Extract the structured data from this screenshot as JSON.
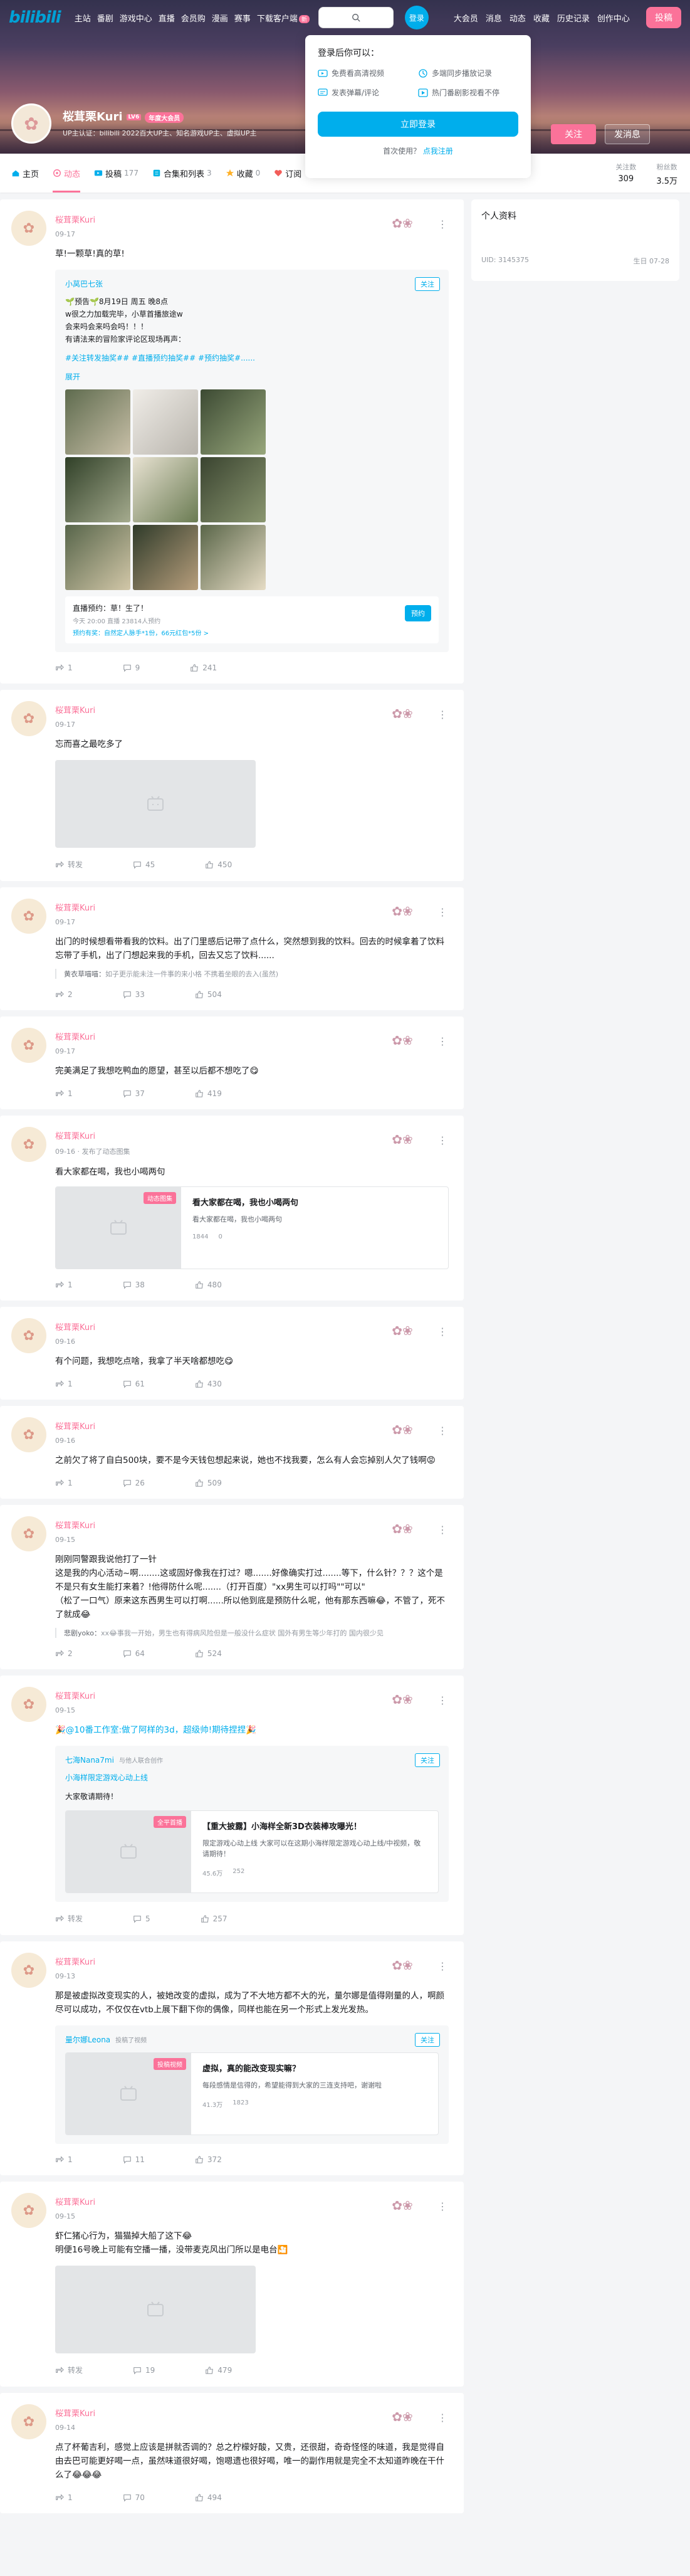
{
  "topbar": {
    "logo": "bilibili",
    "nav": [
      "主站",
      "番剧",
      "游戏中心",
      "直播",
      "会员购",
      "漫画",
      "赛事",
      "下载客户端"
    ],
    "download_badge": "新",
    "login_label": "登录",
    "right_nav": [
      "大会员",
      "消息",
      "动态",
      "收藏",
      "历史记录",
      "创作中心"
    ],
    "upload_label": "投稿"
  },
  "popover": {
    "title": "登录后你可以：",
    "features": [
      "免费看高清视频",
      "多端同步播放记录",
      "发表弹幕/评论",
      "热门番剧影视看不停"
    ],
    "login_button": "立即登录",
    "first_use": "首次使用？",
    "register": "点我注册"
  },
  "profile": {
    "name": "桜茸栗Kuri",
    "level": "LV6",
    "vip": "年度大会员",
    "sign": "UP主认证：bilibili 2022百大UP主、知名游戏UP主、虚拟UP主",
    "follow_button": "关注",
    "message_button": "发消息"
  },
  "tabs": [
    {
      "label": "主页",
      "count": ""
    },
    {
      "label": "动态",
      "count": ""
    },
    {
      "label": "投稿",
      "count": "177"
    },
    {
      "label": "合集和列表",
      "count": "3"
    },
    {
      "label": "收藏",
      "count": "0"
    },
    {
      "label": "订阅",
      "count": ""
    }
  ],
  "stats": [
    {
      "label": "关注数",
      "value": "309"
    },
    {
      "label": "粉丝数",
      "value": "3.5万"
    }
  ],
  "sidebar": {
    "title": "个人资料",
    "uid": "UID: 3145375",
    "birthday": "生日 07-28"
  },
  "posts": [
    {
      "name": "桜茸栗Kuri",
      "time": "09-17",
      "text": "草!一颗草!真的草!",
      "forward": {
        "name": "小莴巴七张",
        "follow": "关注",
        "text": "🌱预告🌱8月19日 周五 晚8点\nw很之力加载完毕，小草首播旅途w\n会来吗会来吗会吗！！！\n有请法来的冒险家评论区现场再声：",
        "tags": "#关注转发抽奖## #直播预约抽奖## #预约抽奖#......",
        "expand": "展开",
        "live_title": "直播预约：草！生了！",
        "live_sub": "今天 20:00 直播   23814人预约",
        "live_link": "预约有奖：自然定人脉手*1份，66元红包*5份 >",
        "live_btn": "预约"
      },
      "forward_count": "1",
      "comment_count": "9",
      "like_count": "241"
    },
    {
      "name": "桜茸栗Kuri",
      "time": "09-17",
      "text": "忘而喜之最吃多了",
      "forward_count": "转发",
      "comment_count": "45",
      "like_count": "450"
    },
    {
      "name": "桜茸栗Kuri",
      "time": "09-17",
      "text": "出门的时候想看带看我的饮料。出了门里感后记带了点什么，突然想到我的饮料。回去的时候拿着了饮料忘带了手机，出了门想起来我的手机，回去又忘了饮料......",
      "comment": {
        "user": "黄衣草喵喵：",
        "text": "如子更示能未注一件事的来小格 不携着坐眼的去入(虽然)"
      },
      "forward_count": "2",
      "comment_count": "33",
      "like_count": "504"
    },
    {
      "name": "桜茸栗Kuri",
      "time": "09-17",
      "text": "完美满足了我想吃鸭血的愿望，甚至以后都不想吃了😋",
      "forward_count": "1",
      "comment_count": "37",
      "like_count": "419"
    },
    {
      "name": "桜茸栗Kuri",
      "time": "09-16 · 发布了动态图集",
      "text": "看大家都在喝，我也小喝两句",
      "box": {
        "tag": "动态图集",
        "title": "看大家都在喝，我也小喝两句",
        "desc": "看大家都在喝，我也小喝两句",
        "views": "1844",
        "cmts": "0"
      },
      "forward_count": "1",
      "comment_count": "38",
      "like_count": "480"
    },
    {
      "name": "桜茸栗Kuri",
      "time": "09-16",
      "text": "有个问题，我想吃点啥，我拿了半天啥都想吃😋",
      "forward_count": "1",
      "comment_count": "61",
      "like_count": "430"
    },
    {
      "name": "桜茸栗Kuri",
      "time": "09-16",
      "text": "之前欠了将了自白500块，要不是今天钱包想起来说，她也不找我要，怎么有人会忘掉别人欠了钱啊😡",
      "forward_count": "1",
      "comment_count": "26",
      "like_count": "509"
    },
    {
      "name": "桜茸栗Kuri",
      "time": "09-15",
      "text": "刚刚同警跟我说他打了一针\n这是我的内心活动~啊........这或固好像我在打过？嗯.......好像确实打过.......等下，什么针？？？这个是不是只有女生能打来着？!他得防什么呢.......（打开百度）\"xx男生可以打吗\"\"可以\"\n（松了一口气）原来这东西男生可以打啊......所以他到底是预防什么呢，他有那东西嘛😂，不管了，死不了就成😂",
      "comment": {
        "user": "悲剧yoko：",
        "text": "xx😂事我一开始，男生也有得病风险但是一般没什么症状 国外有男生等少年打的 国内很少见"
      },
      "forward_count": "2",
      "comment_count": "64",
      "like_count": "524"
    },
    {
      "name": "桜茸栗Kuri",
      "time": "09-15",
      "text": "🎉@10番工作室:做了阿样的3d，超级帅!期待捏捏🎉",
      "forward": {
        "name": "七海Nana7mi",
        "sub": "与他人联合创作",
        "follow": "关注",
        "link": "小海样限定游戏心动上线",
        "text": "大家敬请期待！",
        "box": {
          "tag": "全平首播",
          "title": "【重大披露】小海样全新3D衣装棒攻曝光！",
          "desc": "限定游戏心动上线 大家可以在这期小海样限定游戏心动上线/中视频，敬请期待！",
          "views": "45.6万",
          "cmts": "252"
        }
      },
      "forward_count": "转发",
      "comment_count": "5",
      "like_count": "257"
    },
    {
      "name": "桜茸栗Kuri",
      "time": "09-13",
      "text": "那是被虚拟改变现实的人，被她改变的虚拟，成为了不大地方都不大的光，量尔娜是值得刚量的人，啊颜尽可以成功，不仅仅在vtb上展下翻下你的偶像，同样也能在另一个形式上发光发热。",
      "forward": {
        "name": "量尔娜Leona",
        "sub": "投稿了视频",
        "follow": "关注",
        "box": {
          "tag": "投稿视频",
          "title": "虚拟，真的能改变现实嘛？",
          "desc": "每段感情是信得的，希望能得到大家的三连支持吧，谢谢啦",
          "views": "41.3万",
          "cmts": "1823"
        }
      },
      "forward_count": "1",
      "comment_count": "11",
      "like_count": "372"
    },
    {
      "name": "桜茸栗Kuri",
      "time": "09-15",
      "text": "虾仁猪心行为，猫猫掉大船了这下😂\n明便16号晚上可能有空播一播，没带麦克风出门所以是电台🎦",
      "forward_count": "转发",
      "comment_count": "19",
      "like_count": "479"
    },
    {
      "name": "桜茸栗Kuri",
      "time": "09-14",
      "text": "点了杯葡吉利，感觉上应该是拼就否调的？总之柠檬好酸，又贵，还很甜，奇奇怪怪的味道，我是觉得自由去巴可能更好喝一点，虽然味道很好喝，饱嗯遗也很好喝，唯一的副作用就是完全不太知道昨晚在干什么了😂😂😂",
      "forward_count": "1",
      "comment_count": "70",
      "like_count": "494"
    }
  ]
}
